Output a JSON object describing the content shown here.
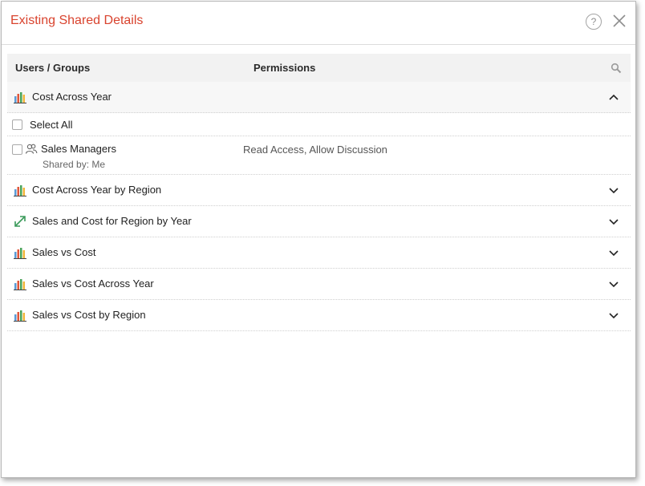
{
  "dialog": {
    "title": "Existing Shared Details",
    "help_label": "?",
    "accent_color": "#d9432e"
  },
  "table": {
    "col_users": "Users / Groups",
    "col_permissions": "Permissions"
  },
  "items": [
    {
      "label": "Cost Across Year",
      "icon": "bar-chart-icon",
      "expanded": true
    },
    {
      "label": "Cost Across Year by Region",
      "icon": "bar-chart-icon",
      "expanded": false
    },
    {
      "label": "Sales and Cost for Region by Year",
      "icon": "diagonal-arrows-icon",
      "expanded": false
    },
    {
      "label": "Sales vs Cost",
      "icon": "bar-chart-icon",
      "expanded": false
    },
    {
      "label": "Sales vs Cost Across Year",
      "icon": "bar-chart-icon",
      "expanded": false
    },
    {
      "label": "Sales vs Cost by Region",
      "icon": "bar-chart-icon",
      "expanded": false
    }
  ],
  "expanded_detail": {
    "select_all_label": "Select All",
    "shares": [
      {
        "name": "Sales Managers",
        "shared_by": "Shared by: Me",
        "permissions": "Read Access, Allow Discussion",
        "icon": "group-icon"
      }
    ]
  }
}
